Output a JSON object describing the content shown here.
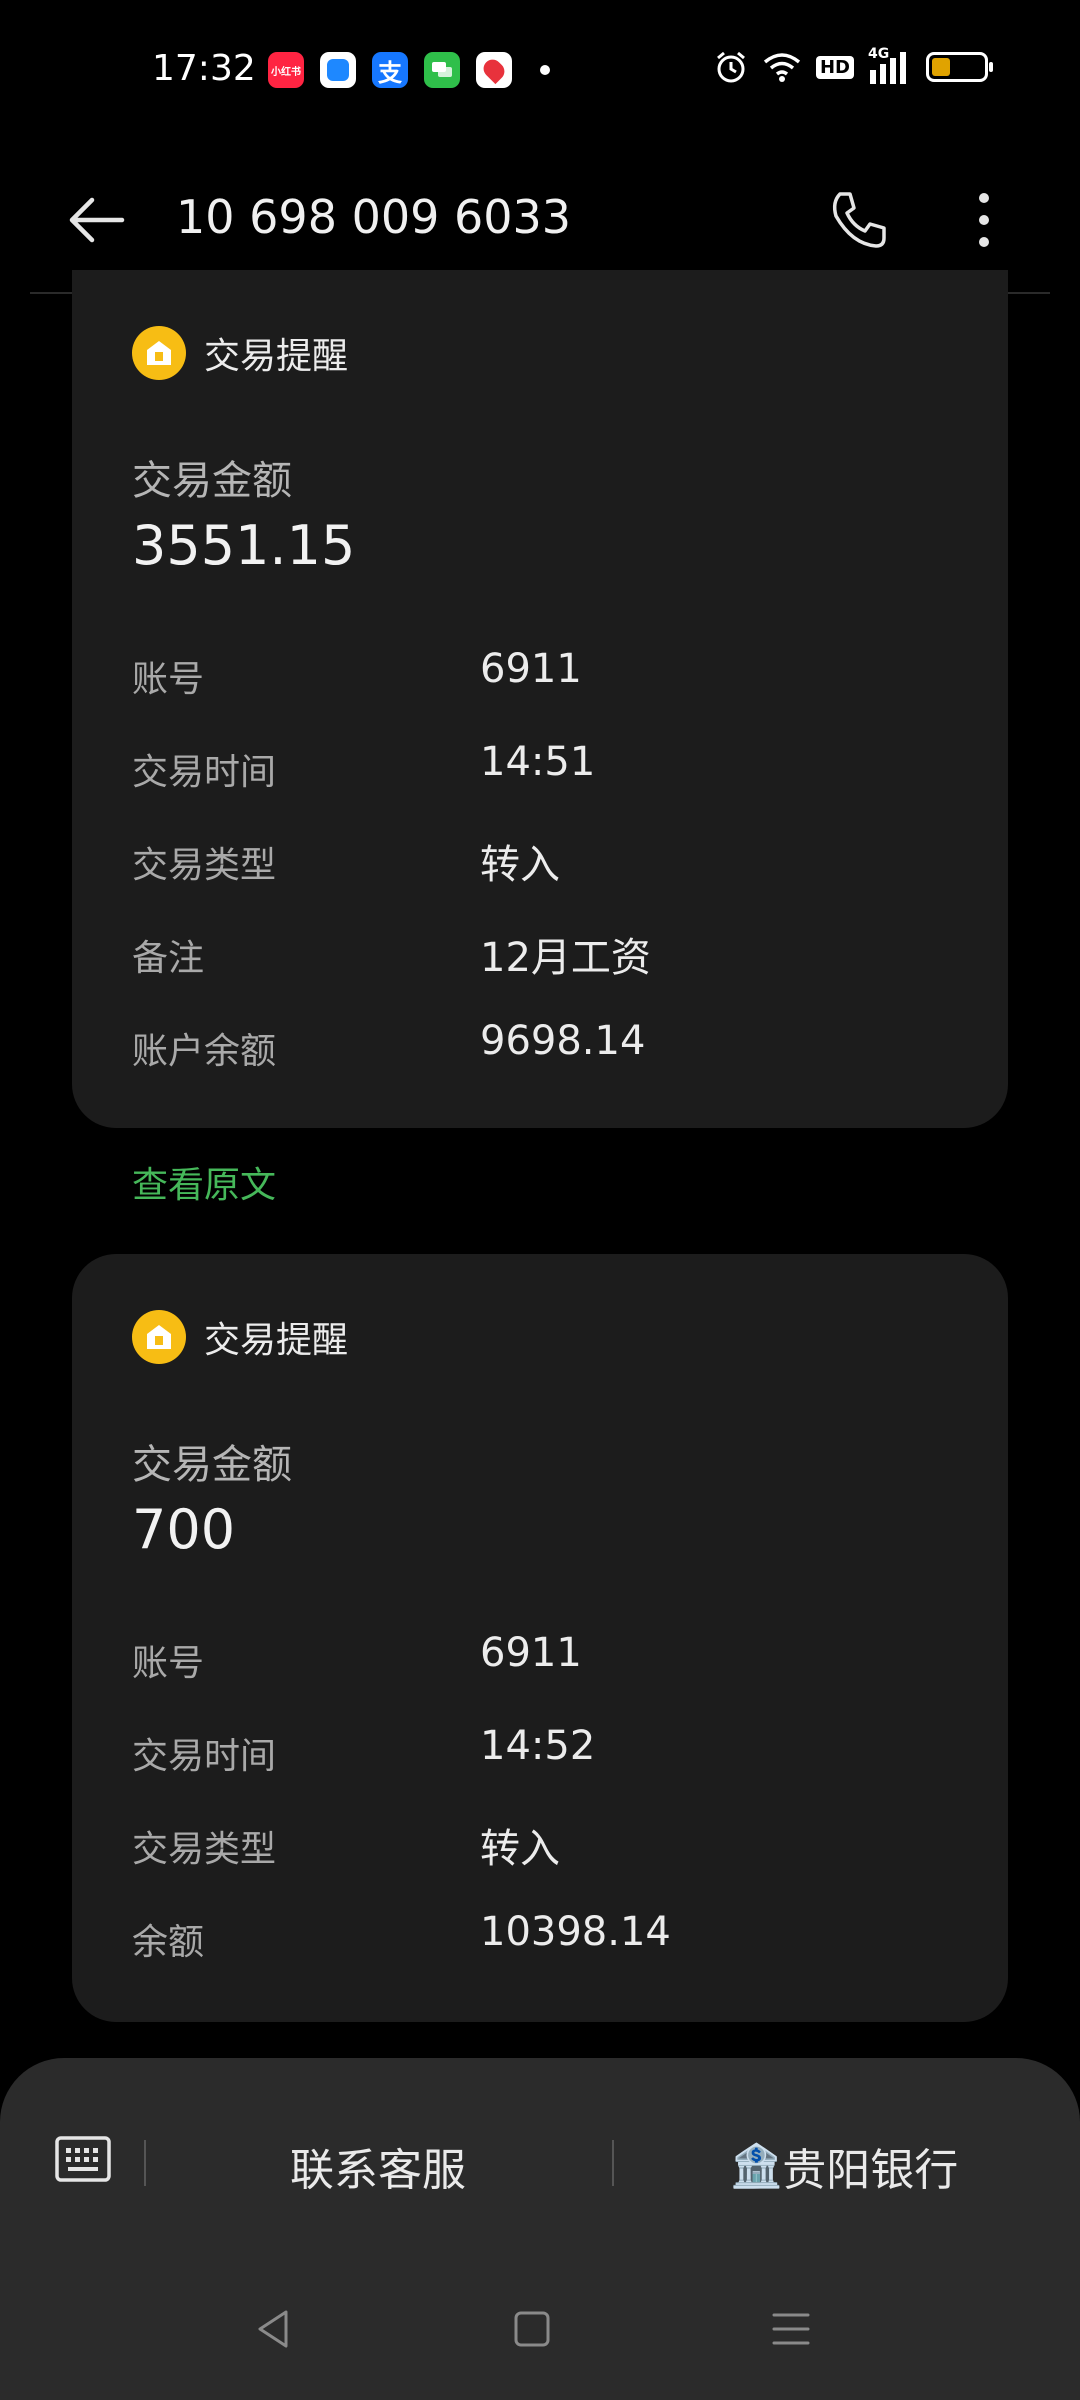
{
  "status_bar": {
    "time": "17:32",
    "app_icons": [
      {
        "name": "xiaohongshu-icon",
        "label": "小红书",
        "color": "#ff2442"
      },
      {
        "name": "blue-app-icon",
        "label": "",
        "color": "#1e88ff"
      },
      {
        "name": "alipay-icon",
        "label": "支",
        "color": "#1677ff"
      },
      {
        "name": "messages-icon",
        "label": "",
        "color": "#2fbf4a"
      },
      {
        "name": "map-app-icon",
        "label": "",
        "color": "#ffffff"
      }
    ],
    "hd": "HD",
    "network": "4G"
  },
  "header": {
    "title": "10 698 009 6033"
  },
  "cards": [
    {
      "title": "交易提醒",
      "amount_label": "交易金额",
      "amount": "3551.15",
      "rows": [
        {
          "label": "账号",
          "value": "6911"
        },
        {
          "label": "交易时间",
          "value": "14:51"
        },
        {
          "label": "交易类型",
          "value": "转入"
        },
        {
          "label": "备注",
          "value": "12月工资"
        },
        {
          "label": "账户余额",
          "value": "9698.14"
        }
      ]
    },
    {
      "title": "交易提醒",
      "amount_label": "交易金额",
      "amount": "700",
      "rows": [
        {
          "label": "账号",
          "value": "6911"
        },
        {
          "label": "交易时间",
          "value": "14:52"
        },
        {
          "label": "交易类型",
          "value": "转入"
        },
        {
          "label": "余额",
          "value": "10398.14"
        }
      ]
    }
  ],
  "view_original": "查看原文",
  "bottom_panel": {
    "contact_service": "联系客服",
    "bank_emoji": "🏦",
    "bank_name": "贵阳银行"
  },
  "colors": {
    "accent_green": "#46b85a",
    "badge_yellow": "#f7bd14",
    "card_bg": "#1c1c1c"
  }
}
